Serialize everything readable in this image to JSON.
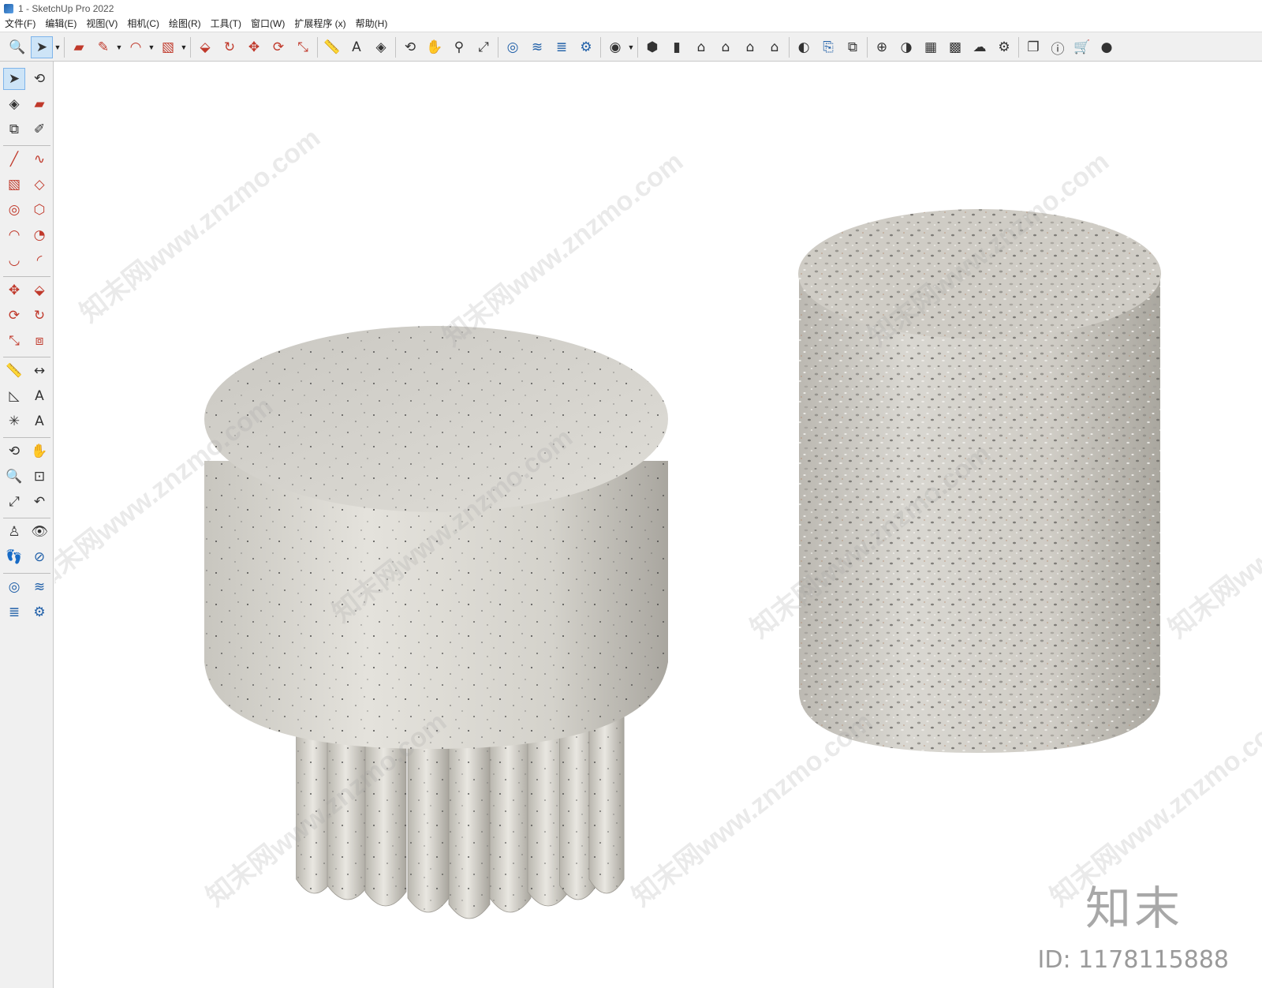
{
  "window": {
    "title": "1 - SketchUp Pro 2022"
  },
  "menubar": {
    "items": [
      {
        "label": "文件(F)"
      },
      {
        "label": "编辑(E)"
      },
      {
        "label": "视图(V)"
      },
      {
        "label": "相机(C)"
      },
      {
        "label": "绘图(R)"
      },
      {
        "label": "工具(T)"
      },
      {
        "label": "窗口(W)"
      },
      {
        "label": "扩展程序 (x)"
      },
      {
        "label": "帮助(H)"
      }
    ]
  },
  "toolbar": {
    "icons": [
      "zoom-icon",
      "select-icon",
      "eraser-icon",
      "pencil-icon",
      "arc-icon",
      "rectangle-icon",
      "push-pull-icon",
      "follow-me-icon",
      "move-icon",
      "rotate-icon",
      "scale-icon",
      "tape-measure-icon",
      "text-icon",
      "paint-bucket-icon",
      "orbit-icon",
      "pan-icon",
      "zoom-tool-icon",
      "zoom-extents-icon",
      "warehouse-icon",
      "extension-warehouse-icon",
      "layout-icon",
      "extension-manager-icon",
      "account-icon",
      "iso-view-icon",
      "top-view-icon",
      "front-view-icon",
      "right-view-icon",
      "back-view-icon",
      "left-view-icon",
      "style-icon",
      "section-icon",
      "components-icon",
      "add-location-icon",
      "shadows-icon",
      "materials-icon",
      "fog-icon",
      "upload-icon",
      "settings-icon",
      "feedback-icon",
      "info-icon",
      "cart-icon",
      "user-icon"
    ]
  },
  "left_toolbar": {
    "icons": [
      "select-icon",
      "orbit-icon",
      "paint-bucket-icon",
      "eraser-icon",
      "make-component-icon",
      "tag-icon",
      "line-icon",
      "freehand-icon",
      "rectangle-icon",
      "rotated-rectangle-icon",
      "circle-icon",
      "polygon-icon",
      "arc-icon",
      "pie-icon",
      "two-point-arc-icon",
      "three-point-arc-icon",
      "move-icon",
      "push-pull-icon",
      "rotate-icon",
      "follow-me-icon",
      "scale-icon",
      "offset-icon",
      "tape-measure-icon",
      "dimension-icon",
      "protractor-icon",
      "text-icon",
      "axes-icon",
      "3d-text-icon",
      "orbit-tool-icon",
      "pan-icon",
      "zoom-icon",
      "zoom-window-icon",
      "zoom-extents-icon",
      "previous-view-icon",
      "position-camera-icon",
      "look-around-icon",
      "walk-icon",
      "section-plane-icon",
      "warehouse-icon",
      "extension-warehouse-icon",
      "layout-icon",
      "extension-manager-icon"
    ]
  },
  "watermarks": [
    "知末网www.znzmo.com"
  ],
  "brand": {
    "logo": "知末",
    "id": "ID: 1178115888"
  },
  "colors": {
    "toolbar_bg": "#f0f0f0",
    "stone_light": "#cfccc4",
    "terrazzo": "#c9c6c0"
  }
}
